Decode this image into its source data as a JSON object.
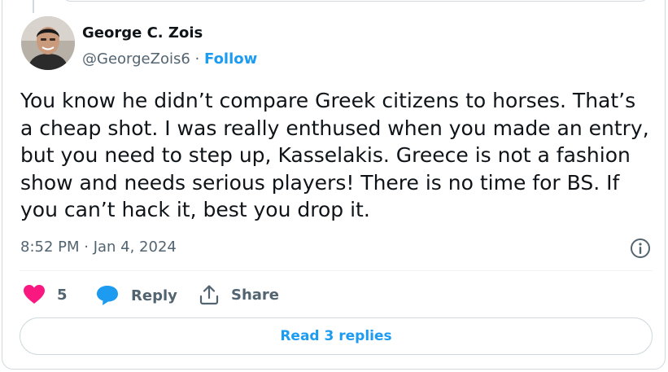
{
  "author": {
    "name": "George C. Zois",
    "handle": "@GeorgeZois6",
    "separator": "·",
    "follow_label": "Follow"
  },
  "tweet": {
    "text": "You know he didn’t compare Greek citizens to horses. That’s a cheap shot. I was really enthused when you made an entry, but you need to step up, Kasselakis. Greece is not a fashion show and needs serious players! There is no time for BS. If you can’t hack it, best you drop it.",
    "timestamp": "8:52 PM · Jan 4, 2024"
  },
  "actions": {
    "like_count": "5",
    "reply_label": "Reply",
    "share_label": "Share"
  },
  "read_replies_label": "Read 3 replies",
  "icons": {
    "like": "heart-icon",
    "reply": "speech-bubble-icon",
    "share": "share-upload-icon",
    "info": "info-icon"
  },
  "colors": {
    "accent": "#1d9bf0",
    "like": "#f91880",
    "text": "#0f1419",
    "secondary": "#536471",
    "border": "#cfd9de"
  }
}
